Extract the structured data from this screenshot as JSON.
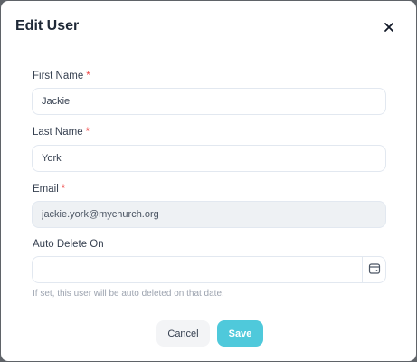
{
  "dialog": {
    "title": "Edit User",
    "close_icon": "close-icon"
  },
  "fields": {
    "first_name": {
      "label": "First Name",
      "required_mark": "*",
      "value": "Jackie"
    },
    "last_name": {
      "label": "Last Name",
      "required_mark": "*",
      "value": "York"
    },
    "email": {
      "label": "Email",
      "required_mark": "*",
      "value": "jackie.york@mychurch.org"
    },
    "auto_delete": {
      "label": "Auto Delete On",
      "value": "",
      "help_text": "If set, this user will be auto deleted on that date.",
      "calendar_icon": "calendar-icon"
    }
  },
  "actions": {
    "cancel_label": "Cancel",
    "save_label": "Save"
  },
  "colors": {
    "save": "#4fc9db",
    "required": "#ef4444",
    "disabled_bg": "#eef1f4"
  }
}
